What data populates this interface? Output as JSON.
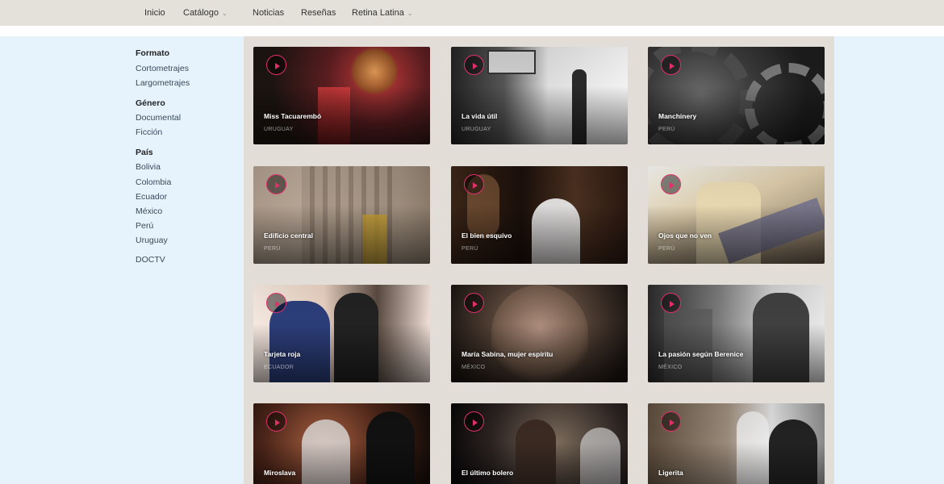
{
  "nav": {
    "items": [
      {
        "label": "Inicio",
        "dropdown": false
      },
      {
        "label": "Catálogo",
        "dropdown": true
      },
      {
        "label": "Noticias",
        "dropdown": false
      },
      {
        "label": "Reseñas",
        "dropdown": false
      },
      {
        "label": "Retina Latina",
        "dropdown": true
      }
    ],
    "chevron": "⌄"
  },
  "sidebar": {
    "formato": {
      "heading": "Formato",
      "links": [
        "Cortometrajes",
        "Largometrajes"
      ]
    },
    "genero": {
      "heading": "Género",
      "links": [
        "Documental",
        "Ficción"
      ]
    },
    "pais": {
      "heading": "País",
      "links": [
        "Bolivia",
        "Colombia",
        "Ecuador",
        "México",
        "Perú",
        "Uruguay"
      ]
    },
    "extra": {
      "link": "DOCTV"
    }
  },
  "films": [
    {
      "title": "Miss Tacuarembó",
      "country": "URUGUAY"
    },
    {
      "title": "La vida útil",
      "country": "URUGUAY"
    },
    {
      "title": "Manchinery",
      "country": "PERÚ"
    },
    {
      "title": "Edificio central",
      "country": "PERÚ"
    },
    {
      "title": "El bien esquivo",
      "country": "PERÚ"
    },
    {
      "title": "Ojos que no ven",
      "country": "PERÚ"
    },
    {
      "title": "Tarjeta roja",
      "country": "ECUADOR"
    },
    {
      "title": "María Sabina, mujer espíritu",
      "country": "MÉXICO"
    },
    {
      "title": "La pasión según Berenice",
      "country": "MÉXICO"
    },
    {
      "title": "Miroslava",
      "country": ""
    },
    {
      "title": "El último bolero",
      "country": ""
    },
    {
      "title": "Ligerita",
      "country": ""
    }
  ],
  "colors": {
    "accent": "#e0306a",
    "nav_bg": "#e4e1db",
    "page_bg": "#e6f3fd",
    "grid_bg": "#e2ded7"
  },
  "icons": {
    "play": "play-icon",
    "dropdown": "chevron-down-icon"
  }
}
